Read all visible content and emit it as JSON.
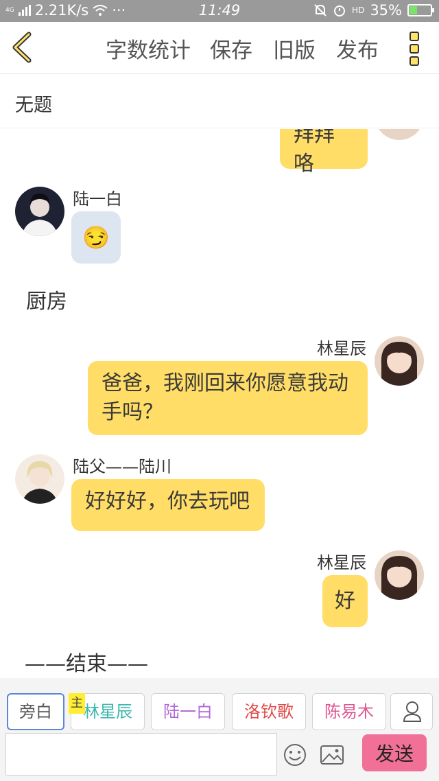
{
  "status_bar": {
    "network_type": "4G",
    "speed": "2.21K/s",
    "dots": "···",
    "time": "11:49",
    "hd": "HD",
    "battery": "35%",
    "battery_level": 0.35
  },
  "toolbar": {
    "back_icon": "chevron-left-icon",
    "word_count_label": "字数统计",
    "save_label": "保存",
    "old_version_label": "旧版",
    "publish_label": "发布",
    "more_icon": "more-vertical-icon"
  },
  "title": "无题",
  "messages": {
    "m1": {
      "text": "拜拜咯"
    },
    "m2": {
      "speaker": "陆一白",
      "emoji": "😏"
    },
    "narration_kitchen": "厨房",
    "m3": {
      "speaker": "林星辰",
      "text": "爸爸，我刚回来你愿意我动手吗？"
    },
    "m4": {
      "speaker": "陆父——陆川",
      "text": "好好好，你去玩吧"
    },
    "m5": {
      "speaker": "林星辰",
      "text": "好"
    },
    "narration_end": "——结束——"
  },
  "roles": {
    "narrator": "旁白",
    "main_tag": "主",
    "lin_xingchen": "林星辰",
    "lu_yibai": "陆一白",
    "luo_qinge": "洛钦歌",
    "chen_yimu": "陈易木",
    "lin_color": "#3bb8b0",
    "lu_color": "#b06ad8",
    "luo_color": "#e04a4a",
    "chen_color": "#e0558f"
  },
  "composer": {
    "input_value": "",
    "send_label": "发送"
  },
  "colors": {
    "bubble": "#ffdd66",
    "bubble_grey": "#dde6f0",
    "send_button": "#f07098",
    "accent": "#ffe36b"
  }
}
